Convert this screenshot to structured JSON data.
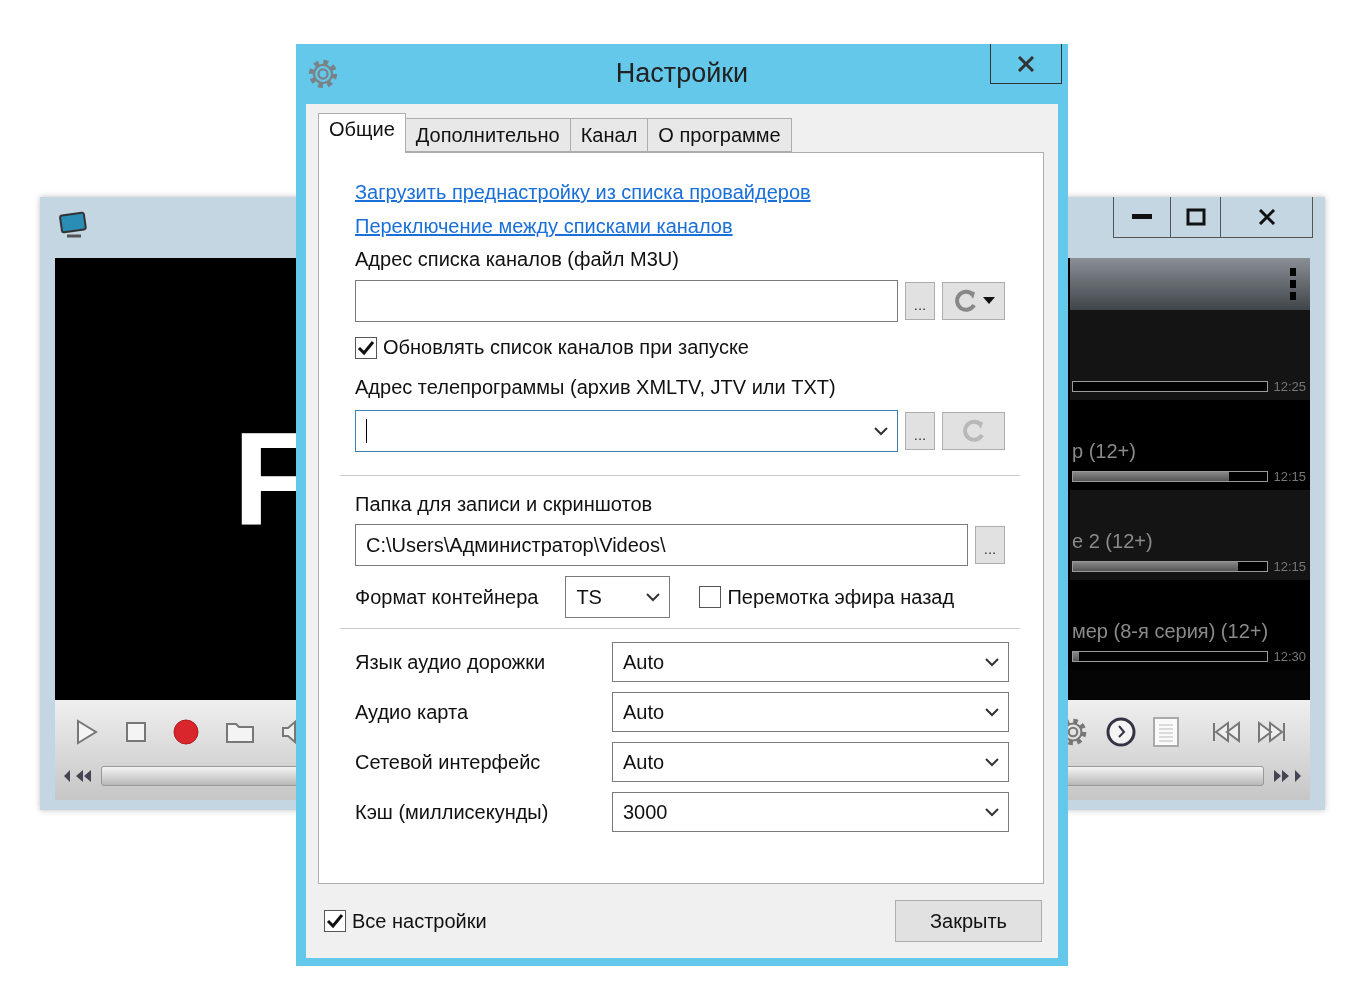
{
  "player": {
    "video_text": "F",
    "channels": [
      {
        "time": "12:25",
        "level": 0
      },
      {
        "title": "р (12+)",
        "time": "12:15",
        "level": 0.8
      },
      {
        "title": "е 2 (12+)",
        "time": "12:15",
        "level": 0.85
      },
      {
        "title": "мер (8-я серия) (12+)",
        "time": "12:30",
        "level": 0.03
      }
    ]
  },
  "dialog": {
    "title": "Настройки",
    "tabs": [
      {
        "label": "Общие",
        "selected": true
      },
      {
        "label": "Дополнительно",
        "selected": false
      },
      {
        "label": "Канал",
        "selected": false
      },
      {
        "label": "О программе",
        "selected": false
      }
    ],
    "links": [
      "Загрузить преднастройку из списка провайдеров",
      "Переключение между списками каналов"
    ],
    "playlist": {
      "label": "Адрес списка каналов (файл M3U)",
      "browse": "...",
      "refresh_disabled": false
    },
    "update_on_start": {
      "label": "Обновлять список каналов при запуске",
      "checked": true
    },
    "epg": {
      "label": "Адрес телепрограммы (архив XMLTV, JTV или TXT)",
      "focused": true,
      "browse": "...",
      "refresh_disabled": true
    },
    "record_folder": {
      "label": "Папка для записи и скриншотов",
      "value": "C:\\Users\\Администратор\\Videos\\",
      "browse": "..."
    },
    "container": {
      "label": "Формат контейнера",
      "value": "TS"
    },
    "timeshift": {
      "label": "Перемотка эфира назад",
      "checked": false
    },
    "selects": [
      {
        "label": "Язык аудио дорожки",
        "value": "Auto"
      },
      {
        "label": "Аудио карта",
        "value": "Auto"
      },
      {
        "label": "Сетевой интерфейс",
        "value": "Auto"
      },
      {
        "label": "Кэш (миллисекунды)",
        "value": "3000"
      }
    ],
    "all_settings": {
      "label": "Все настройки",
      "checked": true
    },
    "close_button": "Закрыть"
  }
}
